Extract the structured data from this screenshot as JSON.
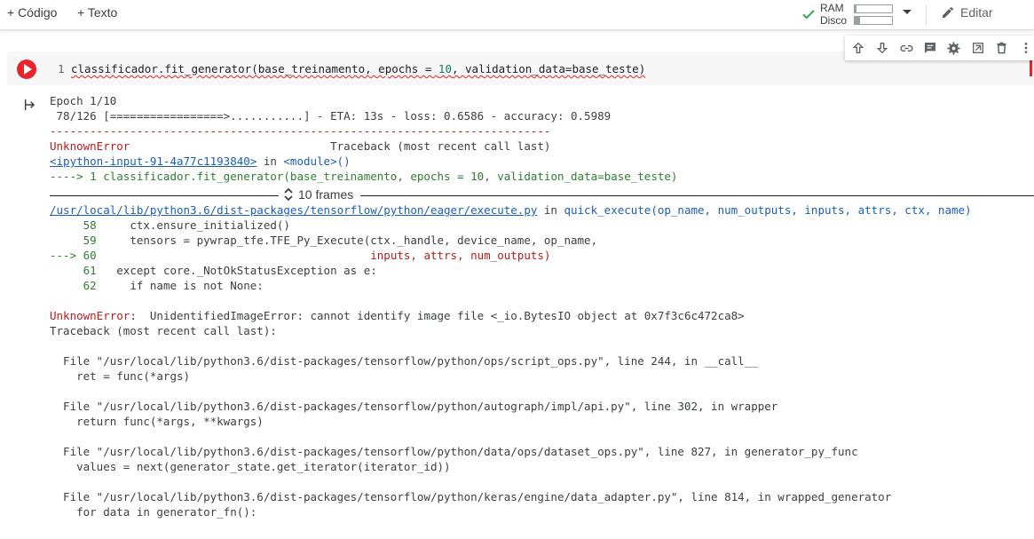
{
  "toolbar": {
    "add_code": "+ Código",
    "add_text": "+ Texto",
    "ram_label": "RAM",
    "disk_label": "Disco",
    "edit_label": "Editar",
    "colors": {
      "check": "#34a853",
      "run_button": "#e8232a"
    }
  },
  "cell": {
    "line_number": "1",
    "code_prefix": "classificador.fit_generator(base_treinamento, epochs = ",
    "code_num": "10",
    "code_suffix": ", validation_data=base_teste)"
  },
  "output": {
    "epoch": "Epoch 1/10",
    "progress": " 78/126 [=================>...........] - ETA: 13s - loss: 0.6586 - accuracy: 0.5989",
    "dashes": "---------------------------------------------------------------------------",
    "err_name": "UnknownError",
    "traceback_hdr": "                              Traceback (most recent call last)",
    "ipy_link": "<ipython-input-91-4a77c1193840>",
    "in_word": " in ",
    "module": "<module>()",
    "arrow_line_prefix": "----> 1 classificador.fit_generator(base_treinamento, epochs = ",
    "arrow_line_num": "10",
    "arrow_line_suffix": ", validation_data=base_teste)",
    "frames_label": "10 frames",
    "exec_path": "/usr/local/lib/python3.6/dist-packages/tensorflow/python/eager/execute.py",
    "exec_in": " in ",
    "exec_func": "quick_execute(op_name, num_outputs, inputs, attrs, ctx, name)",
    "src": [
      {
        "n": "     58",
        "code": "     ctx.ensure_initialized()"
      },
      {
        "n": "     59",
        "code": "     tensors = pywrap_tfe.TFE_Py_Execute(ctx._handle, device_name, op_name,"
      },
      {
        "n": "---> 60",
        "code": "                                         inputs, attrs, num_outputs)"
      },
      {
        "n": "     61",
        "code": "   except core._NotOkStatusException as e:"
      },
      {
        "n": "     62",
        "code": "     if name is not None:"
      }
    ],
    "final_err_name": "UnknownError",
    "final_err_msg": ":  UnidentifiedImageError: cannot identify image file <_io.BytesIO object at 0x7f3c6c472ca8>",
    "traceback2": "Traceback (most recent call last):",
    "frames2": [
      {
        "file": "  File \"/usr/local/lib/python3.6/dist-packages/tensorflow/python/ops/script_ops.py\", line 244, in __call__",
        "code": "    ret = func(*args)"
      },
      {
        "file": "  File \"/usr/local/lib/python3.6/dist-packages/tensorflow/python/autograph/impl/api.py\", line 302, in wrapper",
        "code": "    return func(*args, **kwargs)"
      },
      {
        "file": "  File \"/usr/local/lib/python3.6/dist-packages/tensorflow/python/data/ops/dataset_ops.py\", line 827, in generator_py_func",
        "code": "    values = next(generator_state.get_iterator(iterator_id))"
      },
      {
        "file": "  File \"/usr/local/lib/python3.6/dist-packages/tensorflow/python/keras/engine/data_adapter.py\", line 814, in wrapped_generator",
        "code": "    for data in generator_fn():"
      }
    ]
  }
}
